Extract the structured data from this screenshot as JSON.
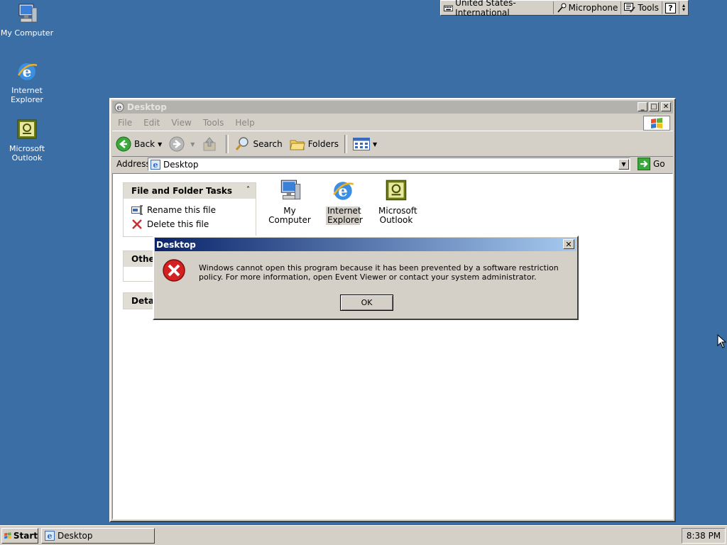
{
  "desktop": {
    "icons": [
      {
        "label": "My Computer"
      },
      {
        "label": "Internet Explorer"
      },
      {
        "label": "Microsoft Outlook"
      }
    ]
  },
  "language_bar": {
    "language": "United States-International",
    "microphone": "Microphone",
    "tools": "Tools",
    "help": "?"
  },
  "window": {
    "title": "Desktop",
    "menu": [
      "File",
      "Edit",
      "View",
      "Tools",
      "Help"
    ],
    "toolbar": {
      "back": "Back",
      "search": "Search",
      "folders": "Folders"
    },
    "address": {
      "label": "Address",
      "value": "Desktop",
      "go": "Go"
    },
    "task_panel": {
      "header": "File and Folder Tasks",
      "items": [
        "Rename this file",
        "Delete this file"
      ]
    },
    "other_panel": {
      "header": "Other"
    },
    "details_panel": {
      "header": "Detail"
    },
    "files": [
      {
        "label": "My Computer"
      },
      {
        "label": "Internet Explorer"
      },
      {
        "label": "Microsoft Outlook"
      }
    ]
  },
  "dialog": {
    "title": "Desktop",
    "message": "Windows cannot open this program because it has been prevented by a software restriction policy. For more information, open Event Viewer or contact your system administrator.",
    "ok": "OK"
  },
  "taskbar": {
    "start": "Start",
    "task": "Desktop",
    "clock": "8:38 PM"
  },
  "colors": {
    "desktop": "#3a6ea5",
    "dialog_title_start": "#0a246a",
    "dialog_title_end": "#a6caf0"
  }
}
